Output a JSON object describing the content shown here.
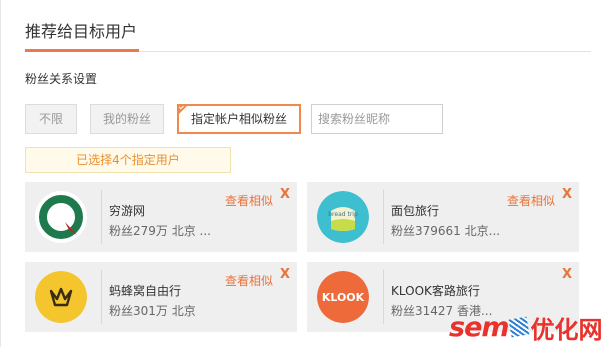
{
  "header": {
    "title": "推荐给目标用户"
  },
  "section": {
    "label": "粉丝关系设置"
  },
  "filters": [
    {
      "label": "不限",
      "active": false
    },
    {
      "label": "我的粉丝",
      "active": false
    },
    {
      "label": "指定帐户相似粉丝",
      "active": true
    }
  ],
  "search": {
    "placeholder": "搜索粉丝昵称",
    "value": ""
  },
  "notice": {
    "text": "已选择4个指定用户"
  },
  "cards": [
    {
      "name": "穷游网",
      "meta": "粉丝279万  北京 ...",
      "action": "查看相似",
      "close": "X",
      "avatar_icon": "qyer-logo-icon"
    },
    {
      "name": "面包旅行",
      "meta": "粉丝379661  北京...",
      "action": "查看相似",
      "close": "X",
      "avatar_icon": "bread-trip-logo-icon",
      "avatar_text": "bread trip"
    },
    {
      "name": "蚂蜂窝自由行",
      "meta": "粉丝301万  北京",
      "action": "查看相似",
      "close": "X",
      "avatar_icon": "mafengwo-logo-icon"
    },
    {
      "name": "KLOOK客路旅行",
      "meta": "粉丝31427  香港...",
      "action": "",
      "close": "X",
      "avatar_icon": "klook-logo-icon",
      "avatar_text": "KLOOK"
    }
  ],
  "watermark": {
    "latin": "sem",
    "cn": "优化网"
  },
  "colors": {
    "accent": "#f08a4b",
    "link": "#e8743b",
    "notice_text": "#e8902f"
  }
}
